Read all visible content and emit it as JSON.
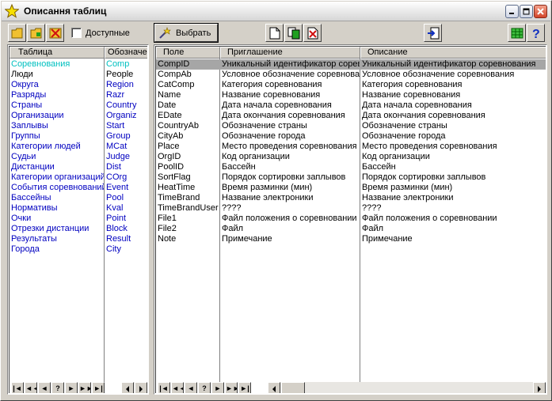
{
  "window": {
    "title": "Описання таблиц"
  },
  "toolbar": {
    "available_label": "Доступные",
    "select_label": "Выбрать"
  },
  "left_table": {
    "columns": [
      "Таблица",
      "Обозначе"
    ],
    "rows": [
      {
        "name": "Соревнования",
        "code": "Comp",
        "selected": true
      },
      {
        "name": "Люди",
        "code": "People"
      },
      {
        "name": "Округа",
        "code": "Region"
      },
      {
        "name": "Разряды",
        "code": "Razr"
      },
      {
        "name": "Страны",
        "code": "Country"
      },
      {
        "name": "Организации",
        "code": "Organiz"
      },
      {
        "name": "Заплывы",
        "code": "Start"
      },
      {
        "name": "Группы",
        "code": "Group"
      },
      {
        "name": "Категории людей",
        "code": "MCat"
      },
      {
        "name": "Судьи",
        "code": "Judge"
      },
      {
        "name": "Дистанции",
        "code": "Dist"
      },
      {
        "name": "Категории организаций",
        "code": "COrg"
      },
      {
        "name": "События соревнований",
        "code": "Event"
      },
      {
        "name": "Бассейны",
        "code": "Pool"
      },
      {
        "name": "Нормативы",
        "code": "Kval"
      },
      {
        "name": "Очки",
        "code": "Point"
      },
      {
        "name": "Отрезки дистанции",
        "code": "Block"
      },
      {
        "name": "Результаты",
        "code": "Result"
      },
      {
        "name": "Города",
        "code": "City"
      }
    ]
  },
  "right_table": {
    "columns": [
      "Поле",
      "Приглашение",
      "Описание"
    ],
    "rows": [
      {
        "field": "CompID",
        "prompt": "Уникальный идентификатор соревнования",
        "desc": "Уникальный идентификатор соревнования",
        "selected": true
      },
      {
        "field": "CompAb",
        "prompt": "Условное обозначение соревнования",
        "desc": "Условное обозначение соревнования"
      },
      {
        "field": "CatComp",
        "prompt": "Категория соревнования",
        "desc": "Категория соревнования"
      },
      {
        "field": "Name",
        "prompt": "Название соревнования",
        "desc": "Название соревнования"
      },
      {
        "field": "Date",
        "prompt": "Дата начала соревнования",
        "desc": "Дата начала соревнования"
      },
      {
        "field": "EDate",
        "prompt": "Дата окончания соревнования",
        "desc": "Дата окончания соревнования"
      },
      {
        "field": "CountryAb",
        "prompt": "Обозначение страны",
        "desc": "Обозначение страны"
      },
      {
        "field": "CityAb",
        "prompt": "Обозначение города",
        "desc": "Обозначение города"
      },
      {
        "field": "Place",
        "prompt": "Место проведения соревнования",
        "desc": "Место проведения соревнования"
      },
      {
        "field": "OrgID",
        "prompt": "Код организации",
        "desc": "Код организации"
      },
      {
        "field": "PoolID",
        "prompt": "Бассейн",
        "desc": "Бассейн"
      },
      {
        "field": "SortFlag",
        "prompt": "Порядок сортировки заплывов",
        "desc": "Порядок сортировки заплывов"
      },
      {
        "field": "HeatTime",
        "prompt": "Время разминки (мин)",
        "desc": "Время разминки (мин)"
      },
      {
        "field": "TimeBrand",
        "prompt": "Название электроники",
        "desc": "Название электроники"
      },
      {
        "field": "TimeBrandUser",
        "prompt": "????",
        "desc": "????"
      },
      {
        "field": "File1",
        "prompt": "Файл положения о соревновании",
        "desc": "Файл положения о соревновании"
      },
      {
        "field": "File2",
        "prompt": "Файл",
        "desc": "Файл"
      },
      {
        "field": "Note",
        "prompt": "Примечание",
        "desc": "Примечание"
      }
    ]
  },
  "navigator": {
    "buttons": [
      "|◄",
      "◄◄",
      "◄",
      "?",
      "►",
      "►►",
      "►|"
    ]
  },
  "colors": {
    "link_text": "#0000c0",
    "selected_left": "#00c0c0",
    "selected_row_bg": "#a6a6a6"
  },
  "icons": [
    "star-icon",
    "open-folder-icon",
    "add-folder-icon",
    "delete-icon",
    "select-wand-icon",
    "new-doc-icon",
    "copy-doc-icon",
    "delete-doc-icon",
    "export-icon",
    "grid-icon",
    "help-icon"
  ]
}
